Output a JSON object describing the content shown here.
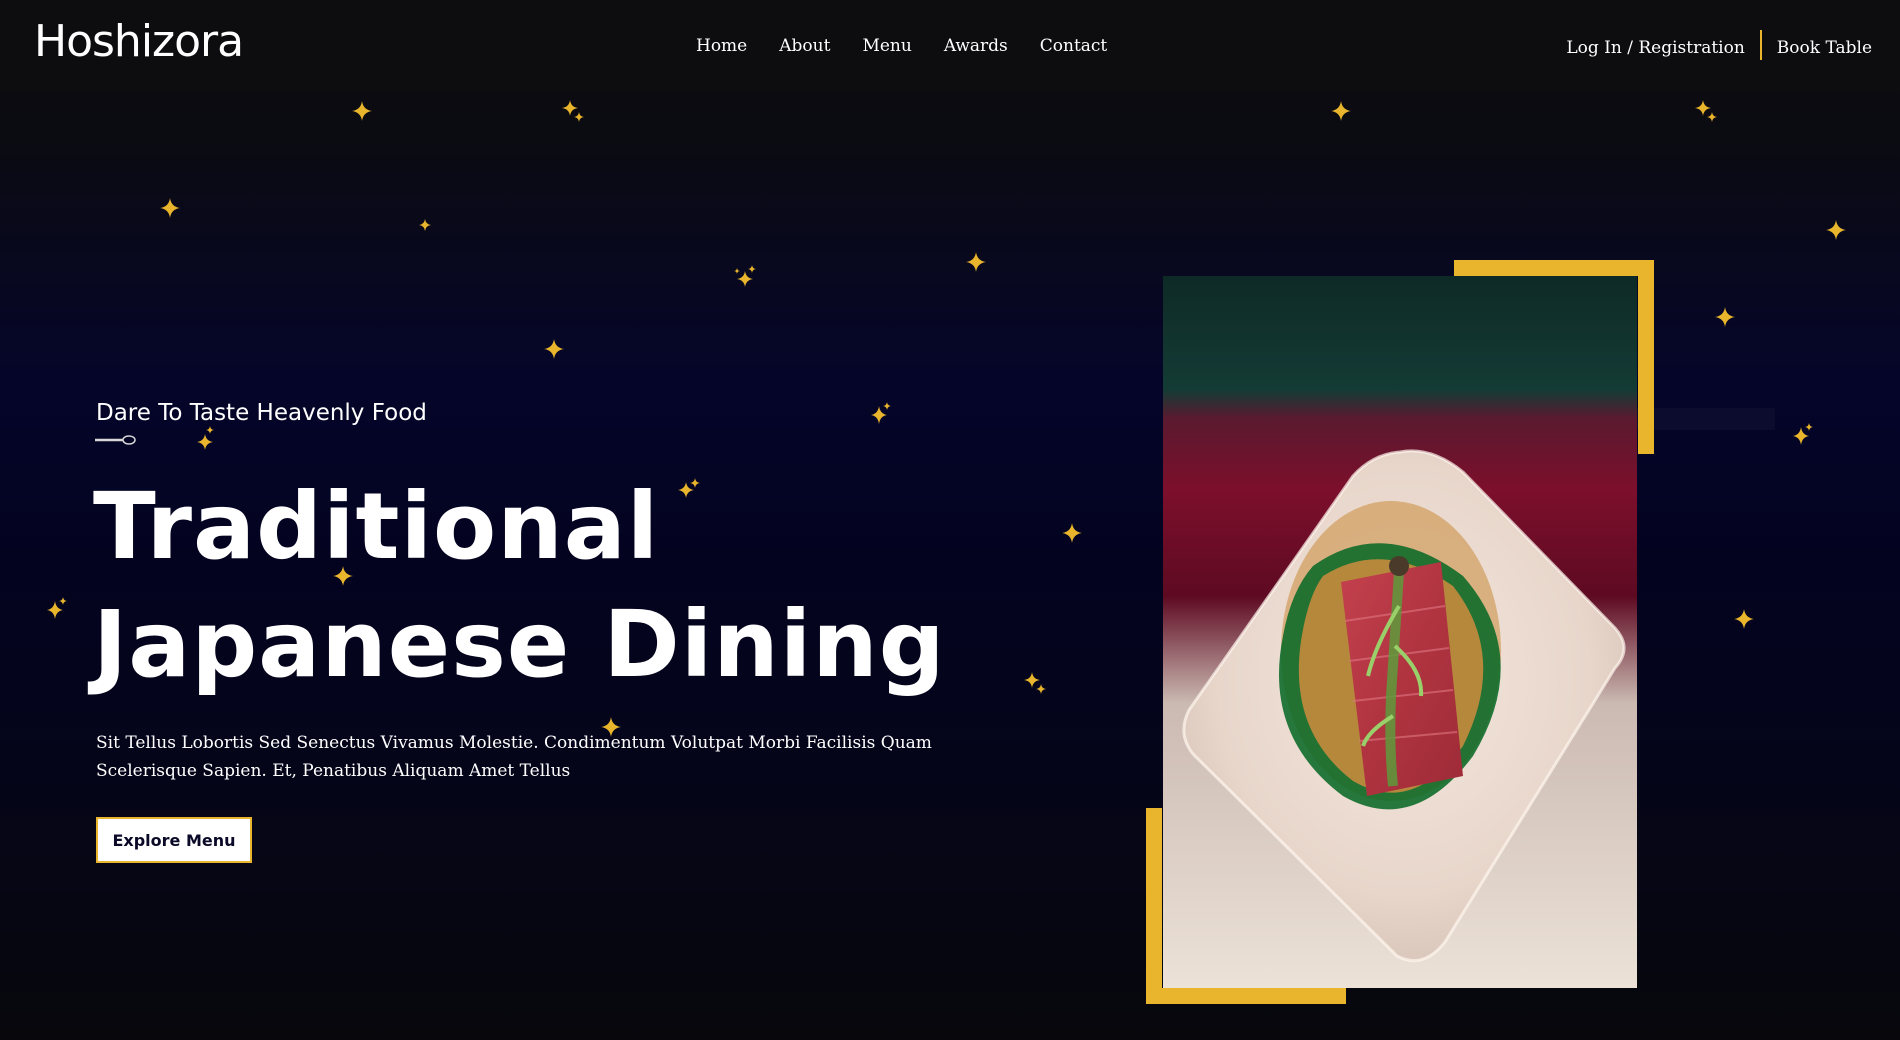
{
  "header": {
    "logo": "Hoshizora",
    "nav": [
      "Home",
      "About",
      "Menu",
      "Awards",
      "Contact"
    ],
    "login_label": "Log In / Registration",
    "book_label": "Book Table"
  },
  "hero": {
    "tagline": "Dare To Taste Heavenly Food",
    "title_line1": "Traditional",
    "title_line2": "Japanese Dining",
    "description": "Sit Tellus Lobortis Sed Senectus Vivamus Molestie. Condimentum Volutpat Morbi Facilisis Quam Scelerisque Sapien. Et, Penatibus Aliquam Amet Tellus",
    "cta_label": "Explore Menu"
  },
  "colors": {
    "accent_gold": "#e8b52c",
    "navy_background": "#03032a",
    "nav_background": "#0d0d0f"
  },
  "icons": {
    "decor": "sparkle-star-icon",
    "tagline_decor": "spoon-icon"
  }
}
